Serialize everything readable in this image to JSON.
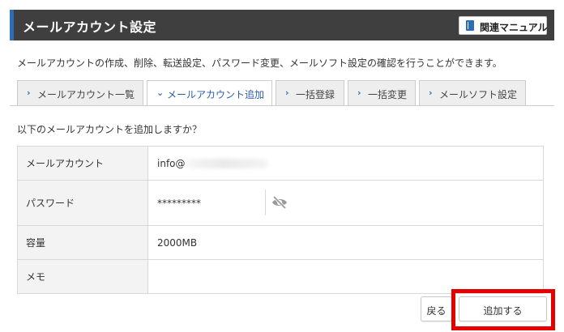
{
  "header": {
    "title": "メールアカウント設定",
    "manual_label": "関連マニュアル"
  },
  "description": "メールアカウントの作成、削除、転送設定、パスワード変更、メールソフト設定の確認を行うことができます。",
  "tabs": [
    {
      "label": "メールアカウント一覧",
      "active": false
    },
    {
      "label": "メールアカウント追加",
      "active": true
    },
    {
      "label": "一括登録",
      "active": false
    },
    {
      "label": "一括変更",
      "active": false
    },
    {
      "label": "メールソフト設定",
      "active": false
    }
  ],
  "question": "以下のメールアカウントを追加しますか？",
  "form": {
    "account": {
      "label": "メールアカウント",
      "value": "info@"
    },
    "password": {
      "label": "パスワード",
      "value": "*********"
    },
    "capacity": {
      "label": "容量",
      "value": "2000MB"
    },
    "memo": {
      "label": "メモ",
      "value": ""
    }
  },
  "buttons": {
    "back": "戻る",
    "add": "追加する"
  },
  "colors": {
    "header_bg": "#3f3f3f",
    "accent": "#2d6db5",
    "highlight": "#e60000"
  }
}
